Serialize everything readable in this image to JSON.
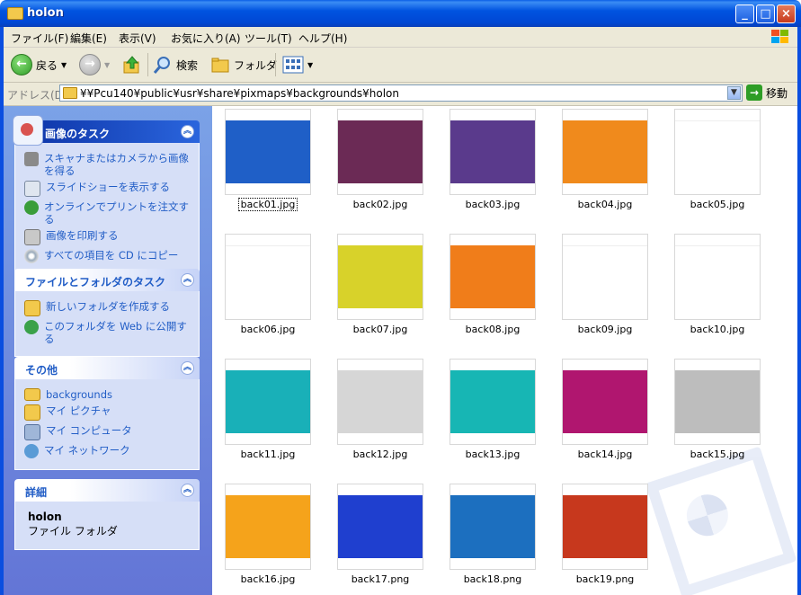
{
  "window": {
    "title": "holon"
  },
  "menu": [
    "ファイル(F)",
    "編集(E)",
    "表示(V)",
    "お気に入り(A)",
    "ツール(T)",
    "ヘルプ(H)"
  ],
  "toolbar": {
    "back": "戻る",
    "search": "検索",
    "folders": "フォルダ"
  },
  "address": {
    "label": "アドレス(D)",
    "path": "¥¥Pcu140¥public¥usr¥share¥pixmaps¥backgrounds¥holon",
    "go": "移動"
  },
  "tasks": {
    "image": {
      "title": "画像のタスク",
      "items": [
        "スキャナまたはカメラから画像を得る",
        "スライドショーを表示する",
        "オンラインでプリントを注文する",
        "画像を印刷する",
        "すべての項目を CD にコピー"
      ]
    },
    "file": {
      "title": "ファイルとフォルダのタスク",
      "items": [
        "新しいフォルダを作成する",
        "このフォルダを Web に公開する"
      ]
    },
    "other": {
      "title": "その他",
      "items": [
        "backgrounds",
        "マイ ピクチャ",
        "マイ コンピュータ",
        "マイ ネットワーク"
      ]
    },
    "details": {
      "title": "詳細",
      "name": "holon",
      "type": "ファイル フォルダ"
    }
  },
  "files": [
    {
      "name": "back01.jpg",
      "color": "#1f5fc7"
    },
    {
      "name": "back02.jpg",
      "color": "#6b2a55"
    },
    {
      "name": "back03.jpg",
      "color": "#5a3a8c"
    },
    {
      "name": "back04.jpg",
      "color": "#f08a1c"
    },
    {
      "name": "back05.jpg",
      "color": "#ffffff"
    },
    {
      "name": "back06.jpg",
      "color": "#ffffff"
    },
    {
      "name": "back07.jpg",
      "color": "#d8d22a"
    },
    {
      "name": "back08.jpg",
      "color": "#f07d1a"
    },
    {
      "name": "back09.jpg",
      "color": "#ffffff"
    },
    {
      "name": "back10.jpg",
      "color": "#ffffff"
    },
    {
      "name": "back11.jpg",
      "color": "#19b0b8"
    },
    {
      "name": "back12.jpg",
      "color": "#d6d6d6"
    },
    {
      "name": "back13.jpg",
      "color": "#17b6b4"
    },
    {
      "name": "back14.jpg",
      "color": "#b0166f"
    },
    {
      "name": "back15.jpg",
      "color": "#bdbdbd"
    },
    {
      "name": "back16.jpg",
      "color": "#f5a31b"
    },
    {
      "name": "back17.png",
      "color": "#1f3fcf"
    },
    {
      "name": "back18.png",
      "color": "#1c6fbf"
    },
    {
      "name": "back19.png",
      "color": "#c7381d"
    }
  ]
}
